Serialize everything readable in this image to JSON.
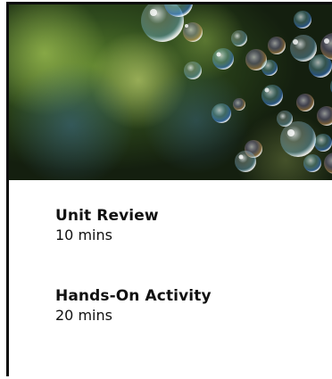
{
  "hero": {
    "image": "soap-bubbles-photo"
  },
  "lessons": [
    {
      "title": "Unit Review",
      "duration": "10 mins"
    },
    {
      "title": "Hands-On Activity",
      "duration": "20 mins"
    }
  ],
  "colors": {
    "text": "#111111",
    "border": "#0b0b0b",
    "background": "#ffffff"
  }
}
